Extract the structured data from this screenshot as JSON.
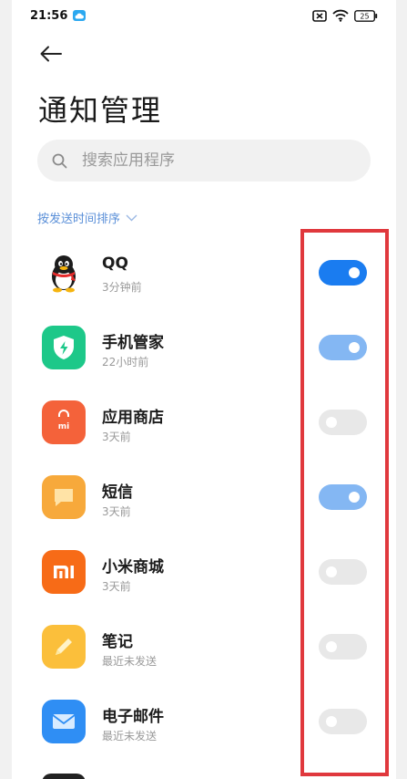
{
  "status_bar": {
    "time": "21:56",
    "battery": "25"
  },
  "header": {
    "title": "通知管理"
  },
  "search": {
    "placeholder": "搜索应用程序"
  },
  "sort": {
    "label": "按发送时间排序"
  },
  "apps": [
    {
      "name": "QQ",
      "subtitle": "3分钟前",
      "toggle": "on",
      "icon": "qq-penguin-icon"
    },
    {
      "name": "手机管家",
      "subtitle": "22小时前",
      "toggle": "on-dim",
      "icon": "security-shield-icon"
    },
    {
      "name": "应用商店",
      "subtitle": "3天前",
      "toggle": "off",
      "icon": "shopping-bag-icon"
    },
    {
      "name": "短信",
      "subtitle": "3天前",
      "toggle": "on-dim",
      "icon": "message-icon"
    },
    {
      "name": "小米商城",
      "subtitle": "3天前",
      "toggle": "off",
      "icon": "mi-logo-icon"
    },
    {
      "name": "笔记",
      "subtitle": "最近未发送",
      "toggle": "off",
      "icon": "notes-icon"
    },
    {
      "name": "电子邮件",
      "subtitle": "最近未发送",
      "toggle": "off",
      "icon": "email-icon"
    }
  ],
  "colors": {
    "accent": "#1a7cf0",
    "accent_dim": "#84b7f3",
    "highlight": "#e0383d"
  }
}
